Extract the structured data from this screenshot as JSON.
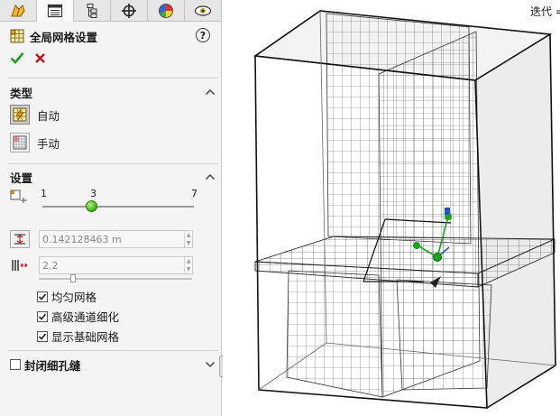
{
  "tabs": [
    {
      "name": "feature-tree-tab",
      "icon": "feature-tree-icon"
    },
    {
      "name": "property-manager-tab",
      "icon": "property-manager-icon"
    },
    {
      "name": "configuration-manager-tab",
      "icon": "configuration-manager-icon"
    },
    {
      "name": "origin-tab",
      "icon": "crosshair-icon"
    },
    {
      "name": "appearance-tab",
      "icon": "appearance-pie-icon"
    },
    {
      "name": "display-tab",
      "icon": "display-manager-icon"
    }
  ],
  "panel": {
    "title": "全局网格设置",
    "help": "?"
  },
  "type_section": {
    "title": "类型",
    "auto_label": "自动",
    "manual_label": "手动",
    "selected": "auto"
  },
  "settings_section": {
    "title": "设置",
    "slider": {
      "min": "1",
      "value": "3",
      "max": "7",
      "level_fraction": 0.333
    },
    "min_gap_value": "0.142128463 m",
    "ratio_value": "2.2",
    "ratio_level_fraction": 0.2
  },
  "checkboxes": [
    {
      "label": "均匀网格",
      "checked": true
    },
    {
      "label": "高级通道细化",
      "checked": true
    },
    {
      "label": "显示基础网格",
      "checked": true
    }
  ],
  "closed_gaps_section": {
    "title": "封闭细孔缝",
    "checked": false
  },
  "viewport": {
    "iteration_text": "迭代 ="
  },
  "colors": {
    "ok_green": "#1f9e1f",
    "cancel_red": "#c0141c",
    "triad_green": "#1aa31a",
    "triad_blue": "#2255cc"
  }
}
